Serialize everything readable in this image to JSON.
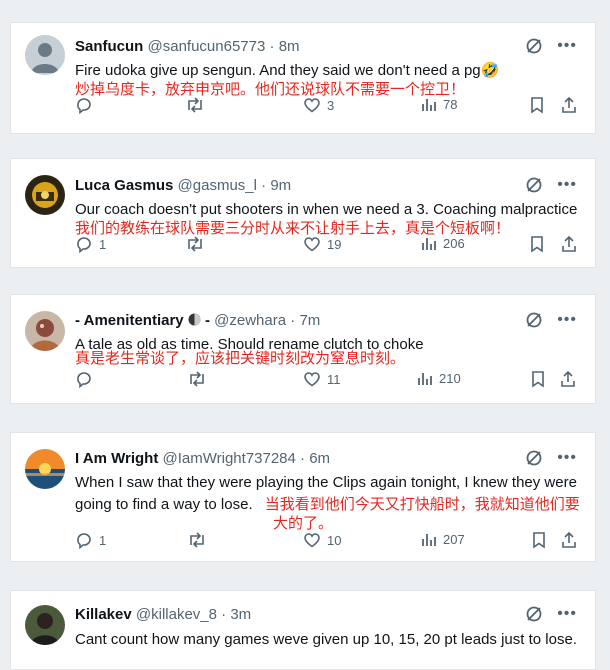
{
  "tweets": [
    {
      "name": "Sanfucun",
      "handle": "@sanfucun65773",
      "dot": "·",
      "time": "8m",
      "text": "Fire udoka give up sengun. And they said we don't need a pg🤣",
      "translation": "炒掉乌度卡，放弃申京吧。他们还说球队不需要一个控卫！",
      "replies": "",
      "retweets": "",
      "likes": "3",
      "views": "78",
      "avatar": "default"
    },
    {
      "name": "Luca Gasmus",
      "handle": "@gasmus_l",
      "dot": "·",
      "time": "9m",
      "text": "Our coach doesn't put shooters in when we need a 3. Coaching malpractice",
      "translation": "我们的教练在球队需要三分时从来不让射手上去，真是个短板啊！",
      "replies": "1",
      "retweets": "",
      "likes": "19",
      "views": "206",
      "avatar": "yellow"
    },
    {
      "name": "- Amenitentiary",
      "name_suffix": "-",
      "handle": "@zewhara",
      "dot": "·",
      "time": "7m",
      "text": "A tale as old as time. Should rename clutch to choke",
      "translation": "真是老生常谈了，应该把关键时刻改为窒息时刻。",
      "replies": "",
      "retweets": "",
      "likes": "11",
      "views": "210",
      "avatar": "art"
    },
    {
      "name": "I Am Wright",
      "handle": "@IamWright737284",
      "dot": "·",
      "time": "6m",
      "text_line1": "When I saw that they were playing the Clips again tonight, I knew they were",
      "text_line2": "going to find a way to lose.",
      "translation_a": "当我看到他们今天又打快船时，我就知道他们要",
      "translation_b": "大的了。",
      "replies": "1",
      "retweets": "",
      "likes": "10",
      "views": "207",
      "avatar": "sunset"
    },
    {
      "name": "Killakev",
      "handle": "@killakev_8",
      "dot": "·",
      "time": "3m",
      "text": "Cant count how many games weve given up 10, 15, 20 pt leads just to lose.",
      "avatar": "person"
    }
  ],
  "colors": {
    "translation": "#e5281f",
    "muted": "#536471",
    "text": "#0f1419"
  }
}
